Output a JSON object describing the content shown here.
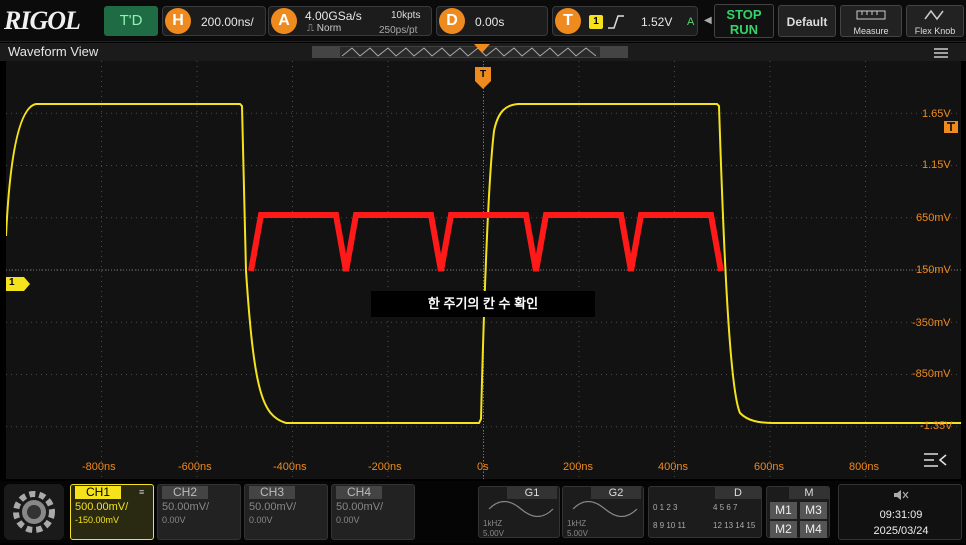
{
  "toolbar": {
    "logo": "RIGOL",
    "mode": "T'D",
    "h_icon": "H",
    "timebase": "200.00ns/",
    "a_icon": "A",
    "sample_rate": "4.00GSa/s",
    "memory_depth": "10kpts",
    "acq_mode": "Norm",
    "resolution": "250ps/pt",
    "d_icon": "D",
    "delay": "0.00s",
    "t_icon": "T",
    "trig_channel": "1",
    "trig_level": "1.52V",
    "trig_flag": "A",
    "stop_label": "STOP",
    "run_label": "RUN",
    "default_label": "Default",
    "measure_label": "Measure",
    "flex_label": "Flex Knob"
  },
  "waveform_view": {
    "title": "Waveform View",
    "trigger_marker": "T",
    "channel_marker": "1",
    "annotation": "한 주기의 칸 수 확인",
    "y_labels": [
      "1.65V",
      "1.15V",
      "650mV",
      "150mV",
      "-350mV",
      "-850mV",
      "-1.35V"
    ],
    "x_labels": [
      "-800ns",
      "-600ns",
      "-400ns",
      "-200ns",
      "0s",
      "200ns",
      "400ns",
      "600ns",
      "800ns"
    ]
  },
  "channels": [
    {
      "name": "CH1",
      "scale": "500.00mV/",
      "offset": "-150.00mV",
      "active": true,
      "color": "#f4e21c"
    },
    {
      "name": "CH2",
      "scale": "50.00mV/",
      "offset": "0.00V",
      "active": false,
      "color": "#888888"
    },
    {
      "name": "CH3",
      "scale": "50.00mV/",
      "offset": "0.00V",
      "active": false,
      "color": "#888888"
    },
    {
      "name": "CH4",
      "scale": "50.00mV/",
      "offset": "0.00V",
      "active": false,
      "color": "#888888"
    }
  ],
  "generators": {
    "g1_label": "G1",
    "g1_freq": "1kHZ",
    "g1_amp": "5.00V",
    "g2_label": "G2",
    "g2_freq": "1kHZ",
    "g2_amp": "5.00V"
  },
  "digital": {
    "label": "D",
    "row1a": "0  1  2  3",
    "row1b": "4  5  6  7",
    "row2a": "8  9  10 11",
    "row2b": "12 13 14 15"
  },
  "math": {
    "label": "M",
    "m1": "M1",
    "m2": "M2",
    "m3": "M3",
    "m4": "M4"
  },
  "status": {
    "time": "09:31:09",
    "date": "2025/03/24"
  },
  "colors": {
    "ch1": "#f4e21c",
    "accent": "#ef8a1e",
    "annotation": "#ff1a1a"
  }
}
